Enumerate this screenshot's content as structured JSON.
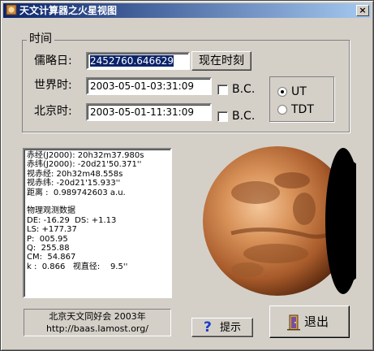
{
  "window": {
    "title": "天文计算器之火星视图",
    "close_symbol": "×"
  },
  "time_group": {
    "label": "时间"
  },
  "julian_day": {
    "label": "儒略日:",
    "value": "2452760.646629",
    "button": "现在时刻"
  },
  "universal_time": {
    "label": "世界时:",
    "value": "2003-05-01-03:31:09",
    "bc_label": "B.C."
  },
  "beijing_time": {
    "label": "北京时:",
    "value": "2003-05-01-11:31:09",
    "bc_label": "B.C."
  },
  "time_system": {
    "options": [
      {
        "label": "UT",
        "selected": true
      },
      {
        "label": "TDT",
        "selected": false
      }
    ]
  },
  "info_lines": [
    "赤经(J2000): 20h32m37.980s",
    "赤纬(J2000): -20d21'50.371''",
    "视赤经: 20h32m48.558s",
    "视赤纬: -20d21'15.933''",
    "距离 :  0.989742603 a.u.",
    "",
    "物理观测数据",
    "DE: -16.29  DS: +1.13",
    "LS: +177.37",
    "P:  005.95",
    "Q:  255.88",
    "CM:  54.867",
    "k :  0.866   视直径:    9.5''"
  ],
  "credit": {
    "line1": "北京天文同好会  2003年",
    "line2": "http://baas.lamost.org/"
  },
  "buttons": {
    "help": "提示",
    "help_icon": "?",
    "exit": "退出"
  },
  "colors": {
    "selection": "#0a246a",
    "titlebar": "#0a246a",
    "face": "#d4d0c8",
    "help_icon": "#1a3cc8"
  }
}
